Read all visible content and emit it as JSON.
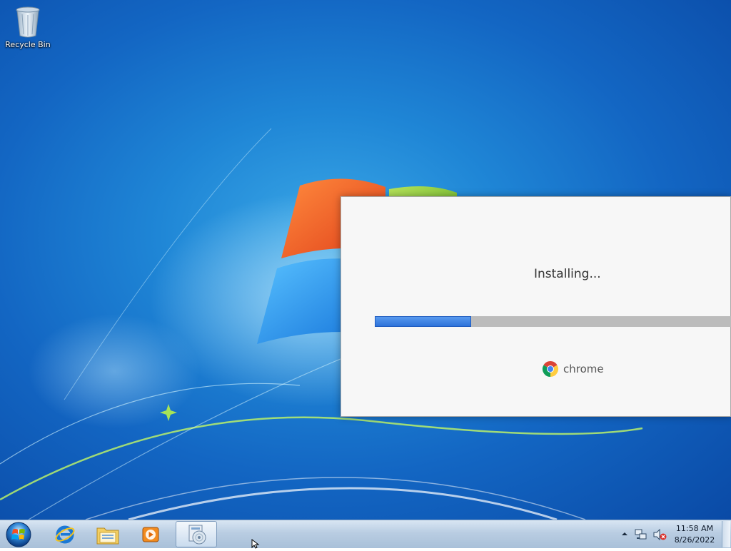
{
  "desktop": {
    "icons": [
      {
        "label": "Recycle Bin",
        "icon": "recycle-bin-icon"
      }
    ]
  },
  "installer": {
    "status": "Installing...",
    "progress_percent": 27,
    "brand": "chrome",
    "brand_icon": "chrome-logo-icon"
  },
  "taskbar": {
    "start_icon": "windows-start-orb-icon",
    "pinned": [
      {
        "name": "Internet Explorer",
        "icon": "internet-explorer-icon",
        "active": false
      },
      {
        "name": "Windows Explorer",
        "icon": "folder-icon",
        "active": false
      },
      {
        "name": "Windows Media Player",
        "icon": "media-player-icon",
        "active": false
      },
      {
        "name": "Installer",
        "icon": "installer-disc-icon",
        "active": true
      }
    ],
    "tray": {
      "show_hidden_icon": "chevron-up-icon",
      "network_icon": "network-icon",
      "volume_icon": "volume-muted-icon",
      "time": "11:58 AM",
      "date": "8/26/2022"
    }
  },
  "colors": {
    "progress_fill": "#2a6fd8",
    "progress_track": "#bcbcbc",
    "taskbar": "#b9cde2"
  }
}
